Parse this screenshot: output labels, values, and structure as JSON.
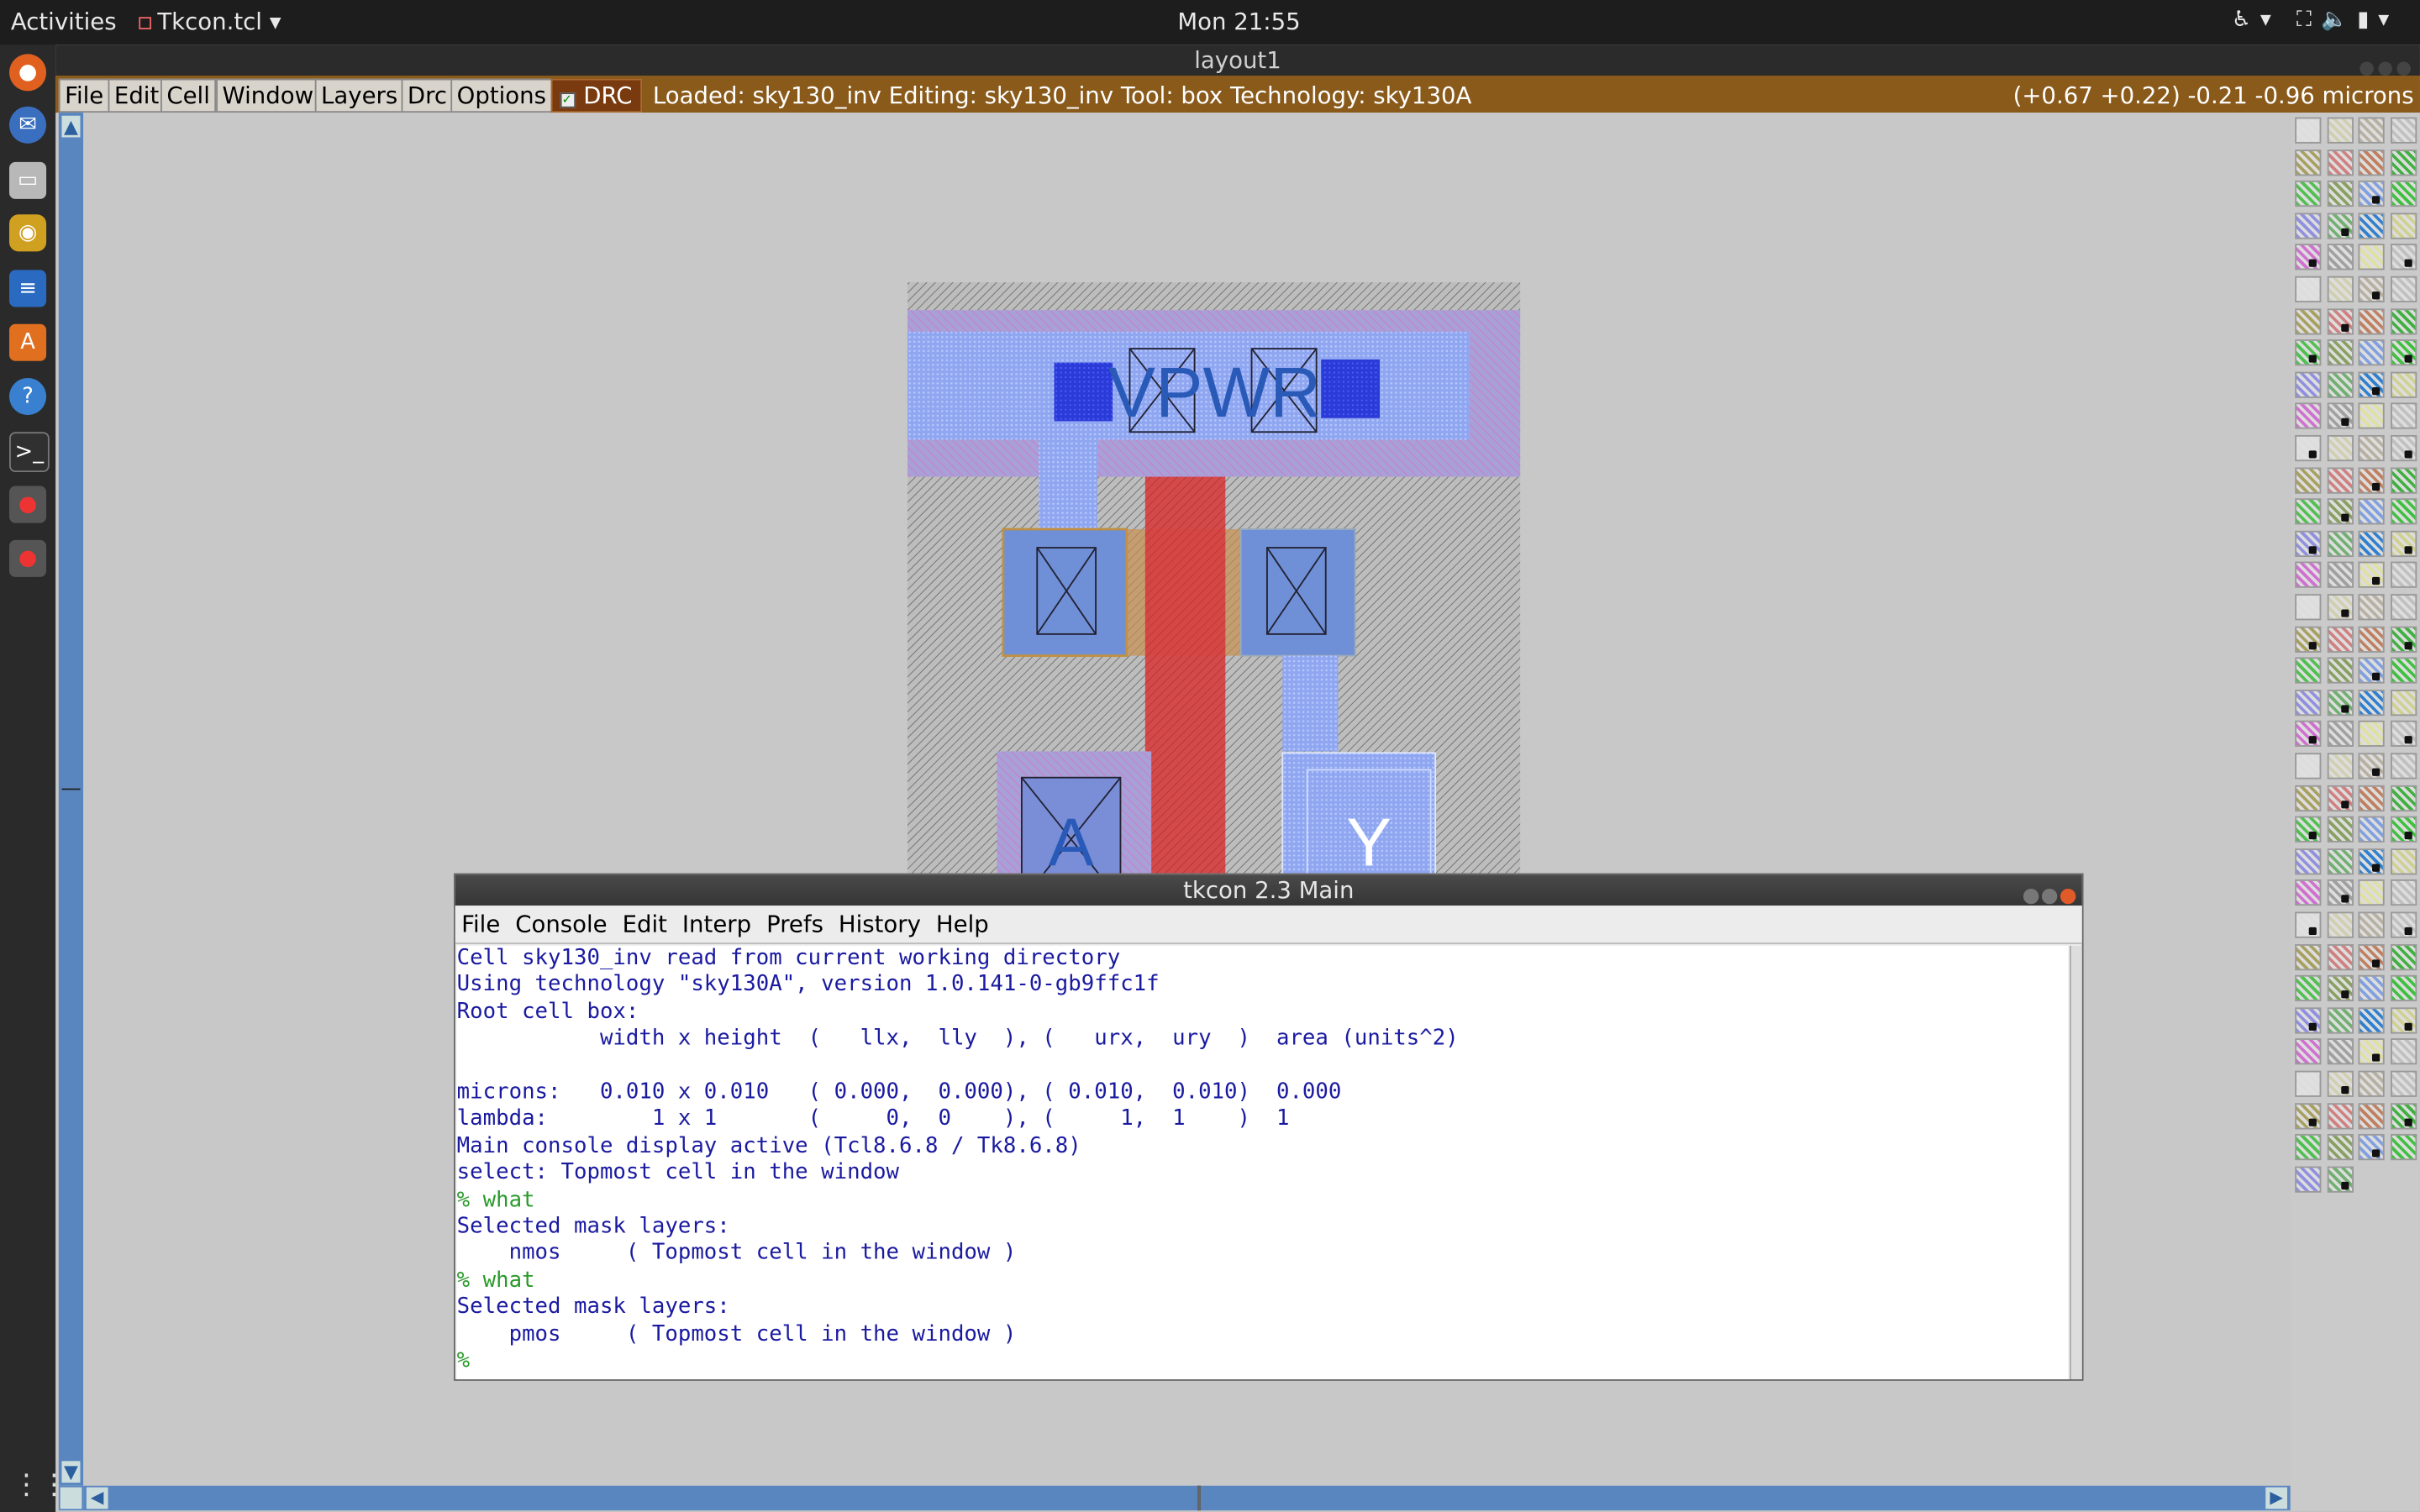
{
  "topbar": {
    "activities": "Activities",
    "app_menu": "Tkcon.tcl",
    "clock": "Mon 21:55"
  },
  "dock": {
    "icons": [
      "firefox-icon",
      "thunderbird-icon",
      "files-icon",
      "rhythmbox-icon",
      "writer-icon",
      "software-icon",
      "help-icon",
      "terminal-icon",
      "magic-icon",
      "magic-icon"
    ]
  },
  "magic_window": {
    "title": "layout1",
    "menus": [
      "File",
      "Edit",
      "Cell",
      "Window",
      "Layers",
      "Drc",
      "Options"
    ],
    "drc_label": "DRC",
    "status": "Loaded: sky130_inv Editing: sky130_inv Tool: box  Technology: sky130A",
    "coords": "(+0.67 +0.22) -0.21 -0.96 microns"
  },
  "layout": {
    "labels": {
      "vpwr": "VPWR",
      "a": "A",
      "y": "Y"
    },
    "colors": {
      "nwell": "#c48fd8",
      "pdiff": "#6a8ee0",
      "poly": "#d84040",
      "metal": "#8aa8f0",
      "contact": "#2b3bd8",
      "label": "#2a5ab8"
    }
  },
  "tkcon": {
    "title": "tkcon 2.3 Main",
    "menus": [
      "File",
      "Console",
      "Edit",
      "Interp",
      "Prefs",
      "History",
      "Help"
    ],
    "lines": [
      "Cell sky130_inv read from current working directory",
      "Using technology \"sky130A\", version 1.0.141-0-gb9ffc1f",
      "Root cell box:",
      "           width x height  (   llx,  lly  ), (   urx,  ury  )  area (units^2)",
      "",
      "microns:   0.010 x 0.010   ( 0.000,  0.000), ( 0.010,  0.010)  0.000",
      "lambda:        1 x 1       (     0,  0    ), (     1,  1    )  1",
      "Main console display active (Tcl8.6.8 / Tk8.6.8)",
      "select: Topmost cell in the window"
    ],
    "prompt1": "% ",
    "cmd1": "what",
    "out1a": "Selected mask layers:",
    "out1b": "    nmos     ( Topmost cell in the window )",
    "prompt2": "% ",
    "cmd2": "what",
    "out2a": "Selected mask layers:",
    "out2b": "    pmos     ( Topmost cell in the window )",
    "prompt3": "%"
  },
  "palette": {
    "swatch_colors": [
      "#e0e0e0",
      "#d8d8c8",
      "#c0c0c0",
      "#d0d0b0",
      "#b0b0b0",
      "#c8c8c8",
      "#b8b0a0",
      "#a8a060",
      "#d0d0c8",
      "#c0c0c0",
      "#d08080",
      "#c8a080",
      "#d06060",
      "#c08060",
      "#50c050",
      "#6ab04a",
      "#40b040",
      "#88a060",
      "#c8a070",
      "#60a0d0",
      "#80a0e0",
      "#9090e0",
      "#e06060",
      "#40c040",
      "#70b070",
      "#c0c0c0",
      "#a0d0a0",
      "#3080d0",
      "#d070d0",
      "#b040b0",
      "#d0d090",
      "#a0a0a0",
      "#000000",
      "#d8d8d8",
      "#e0e0a0"
    ]
  }
}
